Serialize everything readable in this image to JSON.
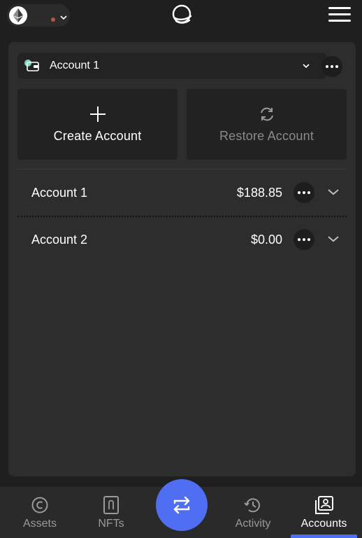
{
  "header": {
    "network_icon": "ethereum-icon",
    "network_status_color": "#c0504d",
    "logo_icon": "app-logo-icon",
    "menu_icon": "hamburger-menu-icon"
  },
  "account_selector": {
    "label": "Account 1",
    "icon": "wallet-icon"
  },
  "actions": {
    "create_label": "Create Account",
    "restore_label": "Restore Account"
  },
  "accounts": [
    {
      "name": "Account 1",
      "balance": "$188.85"
    },
    {
      "name": "Account 2",
      "balance": "$0.00"
    }
  ],
  "nav": {
    "assets": "Assets",
    "nfts": "NFTs",
    "activity": "Activity",
    "accounts": "Accounts",
    "active": "Accounts"
  },
  "colors": {
    "accent": "#4f6ef2",
    "background": "#1f1f1f",
    "card": "#2d2d2d"
  }
}
